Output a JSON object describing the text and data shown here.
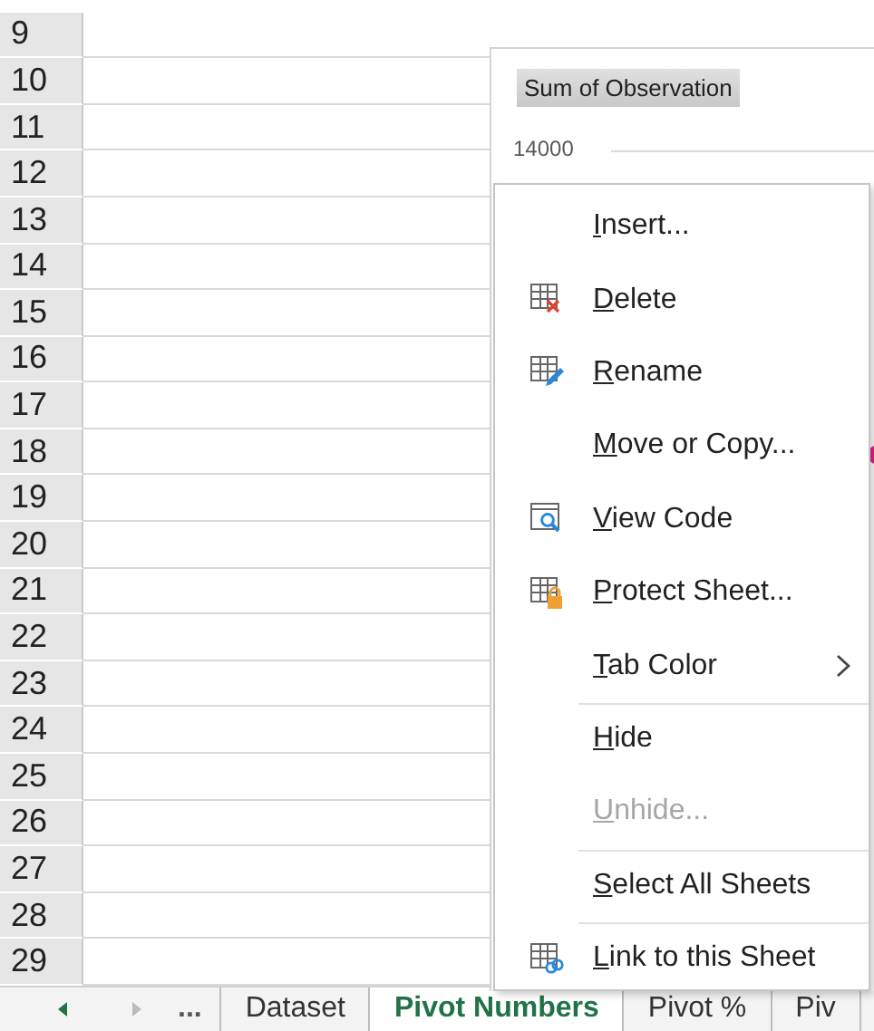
{
  "row_numbers": [
    "9",
    "10",
    "11",
    "12",
    "13",
    "14",
    "15",
    "16",
    "17",
    "18",
    "19",
    "20",
    "21",
    "22",
    "23",
    "24",
    "25",
    "26",
    "27",
    "28",
    "29"
  ],
  "chart": {
    "field_button": "Sum of Observation",
    "y_tick": "14000"
  },
  "context_menu": {
    "items": [
      {
        "label": "Insert...",
        "disabled": false,
        "submenu": false,
        "separator_before": false
      },
      {
        "label": "Delete",
        "disabled": false,
        "submenu": false,
        "separator_before": false
      },
      {
        "label": "Rename",
        "disabled": false,
        "submenu": false,
        "separator_before": false
      },
      {
        "label": "Move or Copy...",
        "disabled": false,
        "submenu": false,
        "separator_before": false
      },
      {
        "label": "View Code",
        "disabled": false,
        "submenu": false,
        "separator_before": false
      },
      {
        "label": "Protect Sheet...",
        "disabled": false,
        "submenu": false,
        "separator_before": false
      },
      {
        "label": "Tab Color",
        "disabled": false,
        "submenu": true,
        "separator_before": false
      },
      {
        "label": "Hide",
        "disabled": false,
        "submenu": false,
        "separator_before": true
      },
      {
        "label": "Unhide...",
        "disabled": true,
        "submenu": false,
        "separator_before": false
      },
      {
        "label": "Select All Sheets",
        "disabled": false,
        "submenu": false,
        "separator_before": true
      },
      {
        "label": "Link to this Sheet",
        "disabled": false,
        "submenu": false,
        "separator_before": true
      }
    ]
  },
  "sheet_tabs": {
    "overflow": "...",
    "tabs": [
      {
        "label": "Dataset",
        "selected": false
      },
      {
        "label": "Pivot Numbers",
        "selected": true
      },
      {
        "label": "Pivot %",
        "selected": false
      },
      {
        "label": "Piv",
        "selected": false
      }
    ]
  }
}
